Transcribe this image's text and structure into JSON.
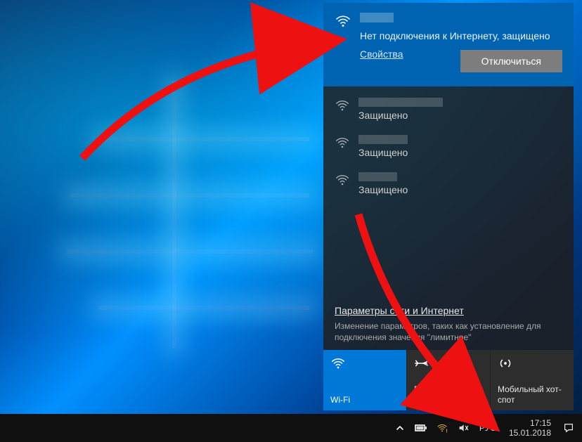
{
  "current_network": {
    "status": "Нет подключения к Интернету, защищено",
    "properties_label": "Свойства",
    "disconnect_label": "Отключиться"
  },
  "other_networks": [
    {
      "name_width": 120,
      "security": "Защищено"
    },
    {
      "name_width": 70,
      "security": "Защищено"
    },
    {
      "name_width": 55,
      "security": "Защищено"
    }
  ],
  "settings": {
    "link": "Параметры сети и Интернет",
    "desc": "Изменение параметров, таких как установление для подключения значения \"лимитное\""
  },
  "tiles": {
    "wifi": "Wi-Fi",
    "airplane": "Режим \"в самолете\"",
    "hotspot": "Мобильный хот-спот"
  },
  "tray": {
    "lang": "РУС",
    "time": "17:15",
    "date": "15.01.2018"
  }
}
